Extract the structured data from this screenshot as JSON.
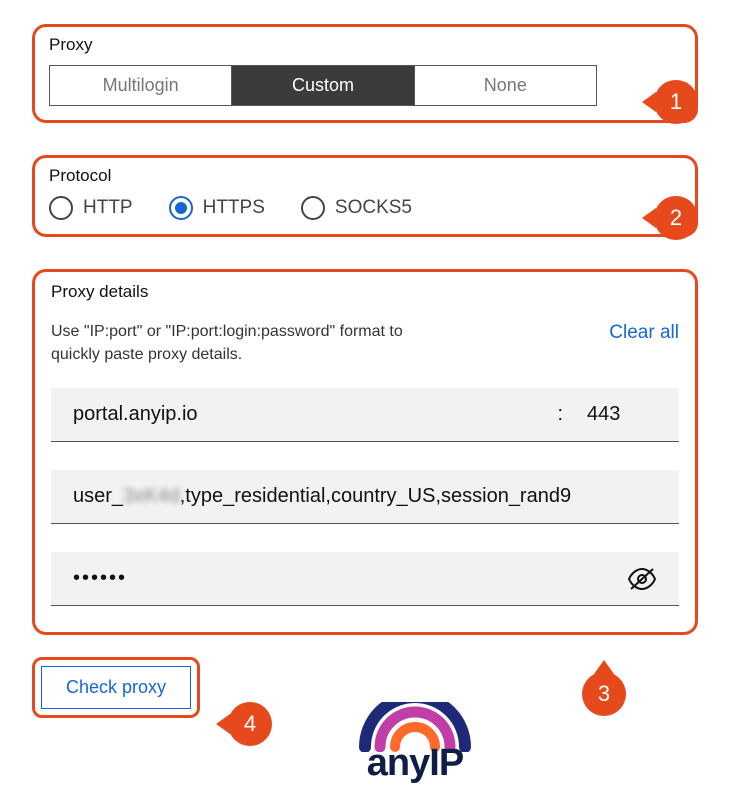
{
  "proxy": {
    "label": "Proxy",
    "tabs": [
      "Multilogin",
      "Custom",
      "None"
    ],
    "selected_index": 1
  },
  "protocol": {
    "label": "Protocol",
    "options": [
      "HTTP",
      "HTTPS",
      "SOCKS5"
    ],
    "selected_index": 1
  },
  "details": {
    "label": "Proxy details",
    "helper": "Use \"IP:port\" or \"IP:port:login:password\" format to quickly paste proxy details.",
    "clear_all": "Clear all",
    "host": "portal.anyip.io",
    "port_sep": ":",
    "port": "443",
    "user_prefix": "user_",
    "user_hidden": "3xK4d",
    "user_suffix": ",type_residential,country_US,session_rand9",
    "password_masked": "••••••"
  },
  "check_proxy_label": "Check proxy",
  "badges": {
    "b1": "1",
    "b2": "2",
    "b3": "3",
    "b4": "4"
  },
  "logo": {
    "text": "anyIP"
  },
  "colors": {
    "accent": "#e64a1c",
    "link": "#1566d6"
  }
}
